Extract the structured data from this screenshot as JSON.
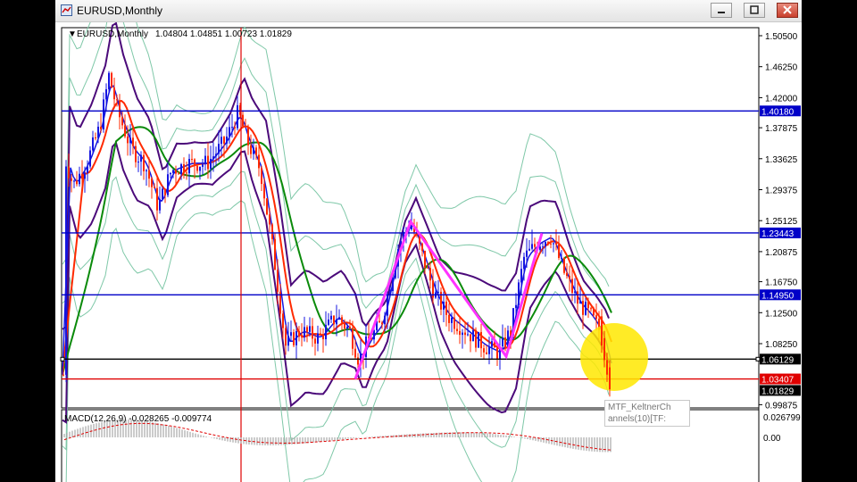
{
  "window": {
    "title": "EURUSD,Monthly",
    "controls": [
      "minimize",
      "restore",
      "close"
    ]
  },
  "chart": {
    "header_symbol": "EURUSD,Monthly",
    "header_ohlc": "1.04804 1.04851 1.00723 1.01829",
    "price_ticks": [
      "1.50500",
      "1.46250",
      "1.42000",
      "1.37875",
      "1.33625",
      "1.29375",
      "1.25125",
      "1.20875",
      "1.16750",
      "1.12500",
      "1.08250",
      "0.99875"
    ],
    "levels": [
      {
        "label": "1.40180",
        "color": "#0000c8",
        "kind": "horizontal-line"
      },
      {
        "label": "1.23443",
        "color": "#0000c8",
        "kind": "horizontal-line"
      },
      {
        "label": "1.14950",
        "color": "#0000c8",
        "kind": "horizontal-line"
      },
      {
        "label": "1.06129",
        "color": "#000000",
        "kind": "horizontal-line"
      },
      {
        "label": "1.03407",
        "color": "#e00000",
        "kind": "horizontal-line"
      }
    ],
    "current_price": "1.01829",
    "colors": {
      "bull": "#1515e0",
      "bear": "#ff2a00",
      "zigzag": "#ff33ff",
      "ma_green": "#0a8a0a",
      "keltner_purple": "#4b0a7a",
      "bands_teal": "#7fc8a8",
      "highlight": "#ffe200"
    }
  },
  "tooltip": {
    "line1": "MTF_KeltnerCh",
    "line2": "annels(10)[TF:"
  },
  "macd": {
    "label": "MACD(12,26,9) -0.028265 -0.009774",
    "ticks": [
      "0.026799",
      "0.00"
    ]
  }
}
